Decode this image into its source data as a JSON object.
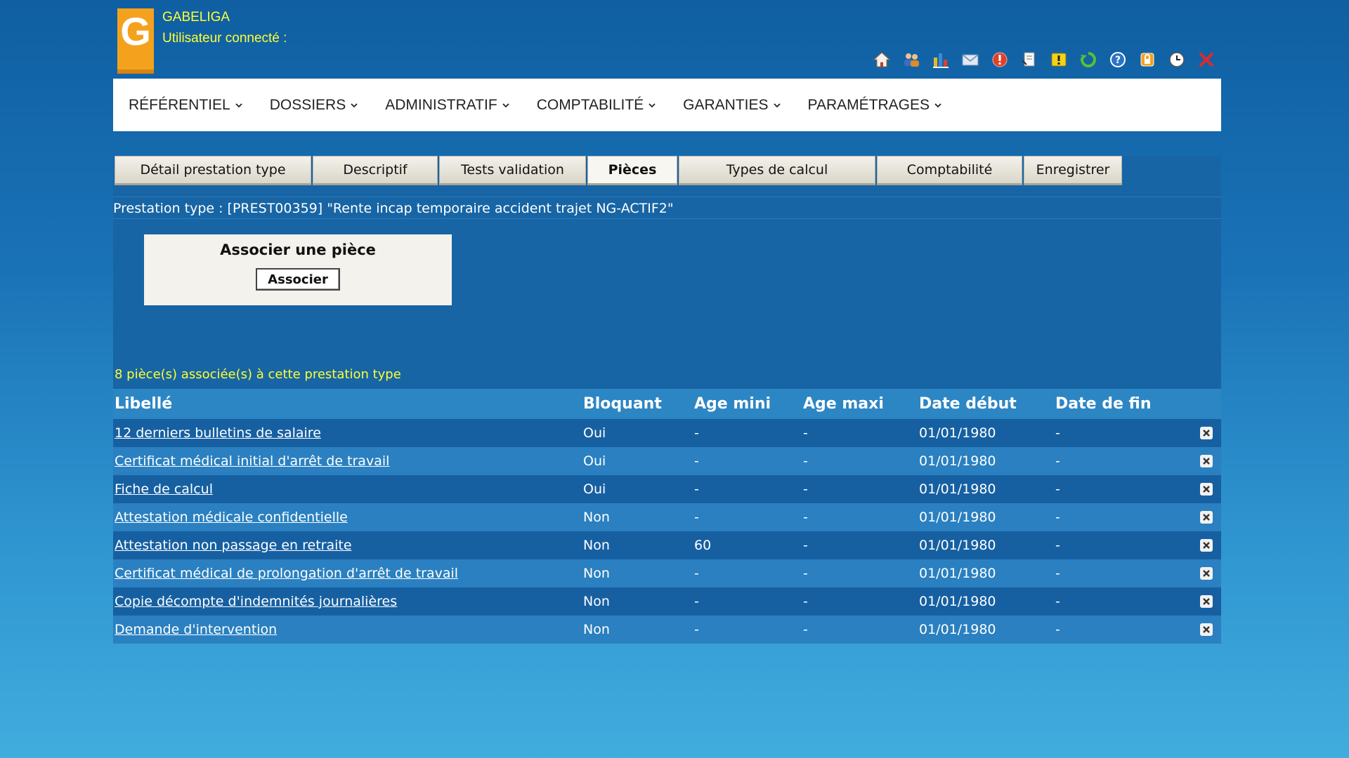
{
  "header": {
    "logo_letter": "G",
    "app_name": "GABELIGA",
    "user_label": "Utilisateur connecté :"
  },
  "toolbar": {
    "icons": [
      "home-icon",
      "users-icon",
      "chart-icon",
      "mail-icon",
      "alert-icon",
      "document-icon",
      "warning-icon",
      "refresh-icon",
      "help-icon",
      "lock-icon",
      "clock-icon",
      "close-icon"
    ]
  },
  "menu": {
    "items": [
      {
        "label": "RÉFÉRENTIEL"
      },
      {
        "label": "DOSSIERS"
      },
      {
        "label": "ADMINISTRATIF"
      },
      {
        "label": "COMPTABILITÉ"
      },
      {
        "label": "GARANTIES"
      },
      {
        "label": "PARAMÉTRAGES"
      }
    ]
  },
  "tabs": [
    {
      "label": "Détail prestation type"
    },
    {
      "label": "Descriptif"
    },
    {
      "label": "Tests validation"
    },
    {
      "label": "Pièces",
      "active": true
    },
    {
      "label": "Types de calcul"
    },
    {
      "label": "Comptabilité"
    },
    {
      "label": "Enregistrer"
    }
  ],
  "prestation": {
    "line": "Prestation type : [PREST00359] \"Rente incap temporaire accident trajet NG-ACTIF2\""
  },
  "associate": {
    "title": "Associer une pièce",
    "button": "Associer"
  },
  "pieces": {
    "count_text": "8 pièce(s) associée(s) à cette prestation type",
    "columns": [
      "Libellé",
      "Bloquant",
      "Age mini",
      "Age maxi",
      "Date début",
      "Date de fin"
    ],
    "rows": [
      {
        "libelle": "12 derniers bulletins de salaire",
        "bloquant": "Oui",
        "age_mini": "-",
        "age_maxi": "-",
        "date_debut": "01/01/1980",
        "date_fin": "-"
      },
      {
        "libelle": "Certificat médical initial d'arrêt de travail",
        "bloquant": "Oui",
        "age_mini": "-",
        "age_maxi": "-",
        "date_debut": "01/01/1980",
        "date_fin": "-"
      },
      {
        "libelle": "Fiche de calcul",
        "bloquant": "Oui",
        "age_mini": "-",
        "age_maxi": "-",
        "date_debut": "01/01/1980",
        "date_fin": "-"
      },
      {
        "libelle": "Attestation médicale confidentielle",
        "bloquant": "Non",
        "age_mini": "-",
        "age_maxi": "-",
        "date_debut": "01/01/1980",
        "date_fin": "-"
      },
      {
        "libelle": "Attestation non passage en retraite",
        "bloquant": "Non",
        "age_mini": "60",
        "age_maxi": "-",
        "date_debut": "01/01/1980",
        "date_fin": "-"
      },
      {
        "libelle": "Certificat médical de prolongation d'arrêt de travail",
        "bloquant": "Non",
        "age_mini": "-",
        "age_maxi": "-",
        "date_debut": "01/01/1980",
        "date_fin": "-"
      },
      {
        "libelle": "Copie décompte d'indemnités journalières",
        "bloquant": "Non",
        "age_mini": "-",
        "age_maxi": "-",
        "date_debut": "01/01/1980",
        "date_fin": "-"
      },
      {
        "libelle": "Demande d'intervention",
        "bloquant": "Non",
        "age_mini": "-",
        "age_maxi": "-",
        "date_debut": "01/01/1980",
        "date_fin": "-"
      }
    ]
  },
  "colors": {
    "accent_yellow": "#ffff33",
    "logo_orange": "#f4a21e",
    "panel_blue": "#1765a5",
    "row_dark": "#1660a2",
    "row_light": "#2a80c0"
  }
}
